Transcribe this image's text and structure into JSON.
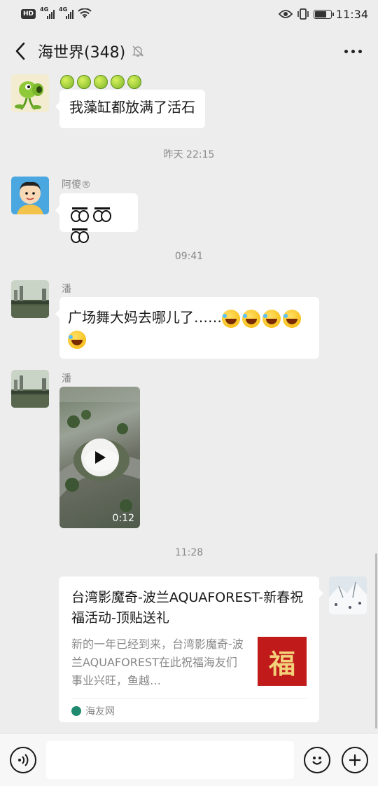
{
  "status_bar": {
    "hd": "HD",
    "net1": "4G",
    "net2": "4G",
    "time": "11:34",
    "battery_level": 0.75
  },
  "header": {
    "title": "海世界(348)",
    "back_icon": "chevron-left-icon",
    "mute_icon": "bell-muted-icon",
    "more_icon": "more-dots-icon"
  },
  "messages": [
    {
      "kind": "text",
      "sender": "",
      "text": "我藻缸都放满了活石",
      "emoji_prefix": "tennis-ball x5"
    },
    {
      "kind": "timestamp",
      "text": "昨天 22:15"
    },
    {
      "kind": "text",
      "sender": "阿傻®",
      "text": "",
      "emoji": "wide-eyes x3"
    },
    {
      "kind": "timestamp",
      "text": "09:41"
    },
    {
      "kind": "text",
      "sender": "潘",
      "text": "广场舞大妈去哪儿了……",
      "emoji_suffix": "laugh-cry x5"
    },
    {
      "kind": "video",
      "sender": "潘",
      "duration": "0:12"
    },
    {
      "kind": "timestamp",
      "text": "11:28"
    },
    {
      "kind": "link",
      "title": "台湾影魔奇-波兰AQUAFOREST-新春祝福活动-顶贴送礼",
      "description": "新的一年已经到来，台湾影魔奇-波兰AQUAFOREST在此祝福海友们事业兴旺，鱼越…",
      "thumb_text": "福",
      "source": "海友网"
    }
  ],
  "input_bar": {
    "voice_icon": "voice-icon",
    "emoji_icon": "emoji-icon",
    "plus_icon": "plus-icon"
  }
}
